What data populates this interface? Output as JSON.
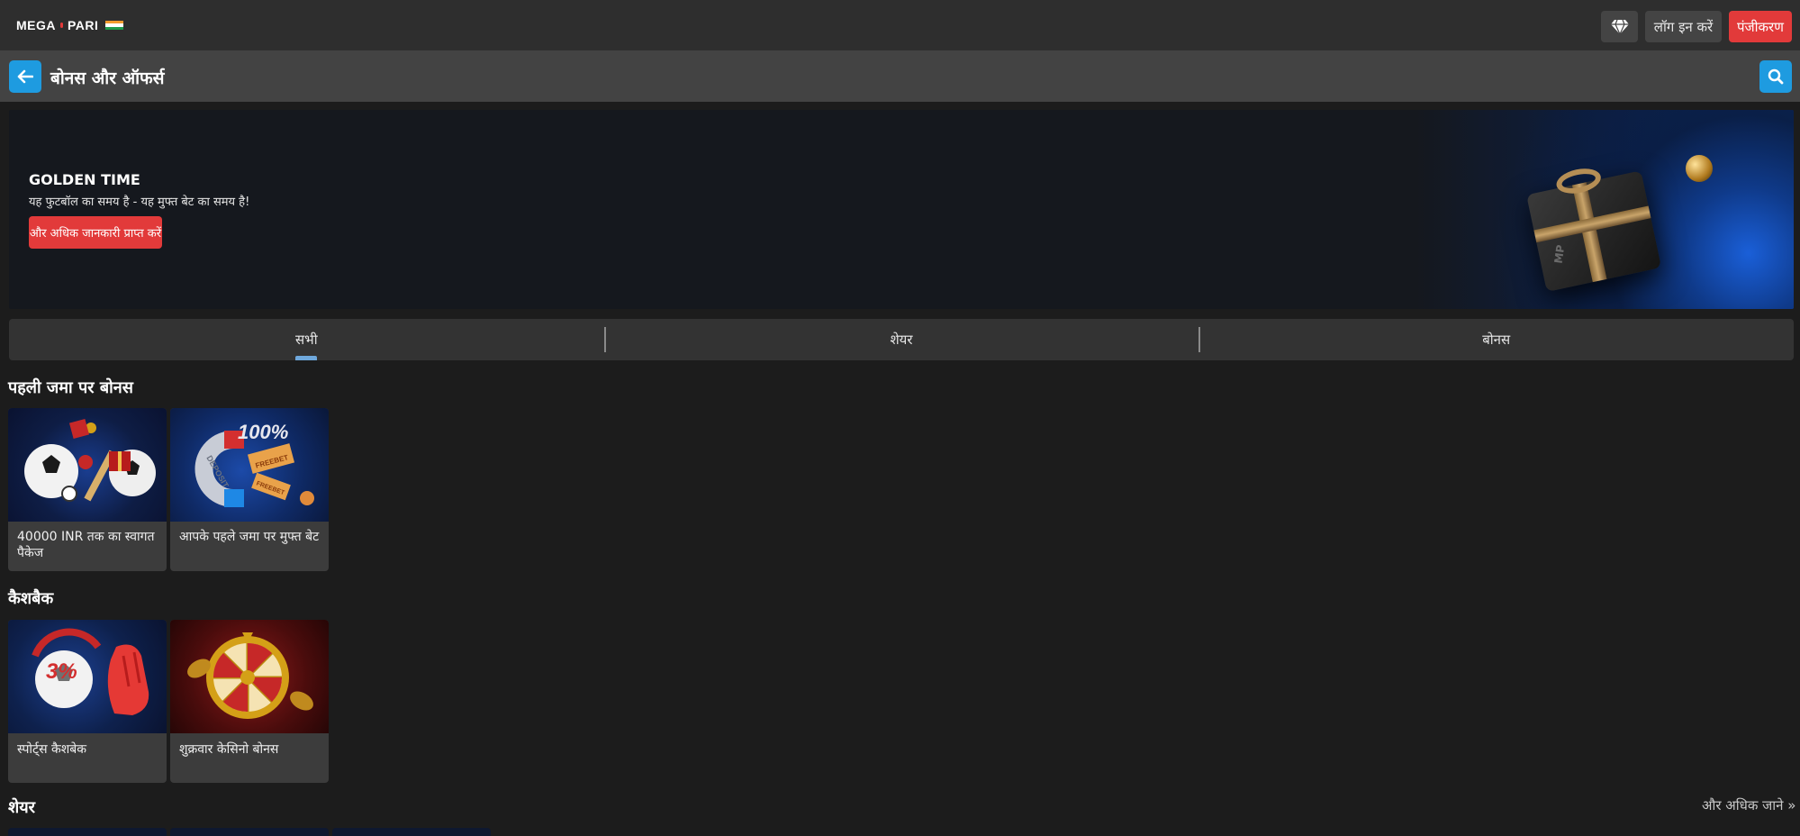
{
  "header": {
    "logo_left": "MEGA",
    "logo_right": "PARI",
    "gem_icon": "diamond-icon",
    "login_label": "लॉग इन करें",
    "register_label": "पंजीकरण"
  },
  "titlebar": {
    "title": "बोनस और ऑफर्स",
    "back_icon": "arrow-left-icon",
    "search_icon": "search-icon"
  },
  "banner": {
    "title": "GOLDEN TIME",
    "subtitle": "यह फुटबॉल का समय है - यह मुफ्त बेट का समय है!",
    "cta_label": "और अधिक जानकारी प्राप्त करें",
    "gift_mark": "MP"
  },
  "tabs": [
    {
      "label": "सभी",
      "active": true
    },
    {
      "label": "शेयर",
      "active": false
    },
    {
      "label": "बोनस",
      "active": false
    }
  ],
  "sections": {
    "first_deposit": {
      "title": "पहली जमा पर बोनस",
      "cards": [
        {
          "label": "40000 INR तक का स्वागत पैकेज",
          "badge": ""
        },
        {
          "label": "आपके पहले जमा पर मुफ्त बेट",
          "badge": "100%",
          "ticket_text": "FREEBET",
          "magnet_text": "DEPOSIT"
        }
      ]
    },
    "cashback": {
      "title": "कैशबैक",
      "cards": [
        {
          "label": "स्पोर्ट्स कैशबेक",
          "badge": "3%"
        },
        {
          "label": "शुक्रवार केसिनो बोनस",
          "badge": ""
        }
      ]
    },
    "shares": {
      "title": "शेयर",
      "more_label": "और अधिक जाने »"
    }
  },
  "colors": {
    "accent_blue": "#1e9be0",
    "accent_red": "#e23a3a",
    "header_bg": "#2e2e2e",
    "titlebar_bg": "#434343",
    "page_bg": "#1c1c1c"
  }
}
